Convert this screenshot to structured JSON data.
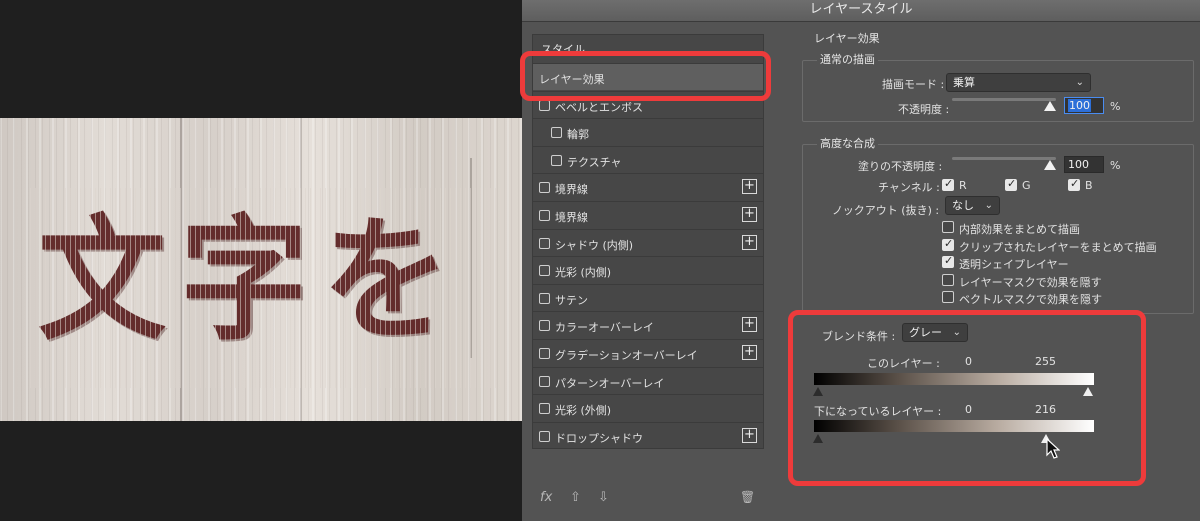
{
  "artwork": {
    "text": "文字を"
  },
  "dialog": {
    "title": "レイヤースタイル",
    "style_header": "スタイル",
    "style_items": [
      {
        "label": "レイヤー効果",
        "checkbox": false,
        "plus": false,
        "selected": true
      },
      {
        "label": "ベベルとエンボス",
        "checkbox": true,
        "plus": false
      },
      {
        "label": "輪郭",
        "checkbox": true,
        "plus": false,
        "indent": true
      },
      {
        "label": "テクスチャ",
        "checkbox": true,
        "plus": false,
        "indent": true
      },
      {
        "label": "境界線",
        "checkbox": true,
        "plus": true
      },
      {
        "label": "境界線",
        "checkbox": true,
        "plus": true
      },
      {
        "label": "シャドウ (内側)",
        "checkbox": true,
        "plus": true
      },
      {
        "label": "光彩 (内側)",
        "checkbox": true,
        "plus": false
      },
      {
        "label": "サテン",
        "checkbox": true,
        "plus": false
      },
      {
        "label": "カラーオーバーレイ",
        "checkbox": true,
        "plus": true
      },
      {
        "label": "グラデーションオーバーレイ",
        "checkbox": true,
        "plus": true
      },
      {
        "label": "パターンオーバーレイ",
        "checkbox": true,
        "plus": false
      },
      {
        "label": "光彩 (外側)",
        "checkbox": true,
        "plus": false
      },
      {
        "label": "ドロップシャドウ",
        "checkbox": true,
        "plus": true
      }
    ],
    "footer": {
      "fx": "fx",
      "up": "⇧",
      "down": "⇩",
      "trash": "🗑"
    },
    "layer_effects_title": "レイヤー効果",
    "normal_blend": {
      "title": "通常の描画",
      "blend_mode_label": "描画モード :",
      "blend_mode_value": "乗算",
      "opacity_label": "不透明度 :",
      "opacity_value": "100",
      "opacity_unit": "%"
    },
    "advanced_blend": {
      "title": "高度な合成",
      "fill_opacity_label": "塗りの不透明度 :",
      "fill_opacity_value": "100",
      "fill_opacity_unit": "%",
      "channels_label": "チャンネル :",
      "channels": [
        "R",
        "G",
        "B"
      ],
      "knockout_label": "ノックアウト (抜き) :",
      "knockout_value": "なし",
      "options": [
        {
          "label": "内部効果をまとめて描画",
          "checked": false
        },
        {
          "label": "クリップされたレイヤーをまとめて描画",
          "checked": true
        },
        {
          "label": "透明シェイプレイヤー",
          "checked": true
        },
        {
          "label": "レイヤーマスクで効果を隠す",
          "checked": false
        },
        {
          "label": "ベクトルマスクで効果を隠す",
          "checked": false
        }
      ]
    },
    "blend_if": {
      "label": "ブレンド条件 :",
      "value": "グレー",
      "this_layer_label": "このレイヤー :",
      "this_layer_min": "0",
      "this_layer_max": "255",
      "underlying_label": "下になっているレイヤー :",
      "underlying_min": "0",
      "underlying_max": "216"
    },
    "colors": {
      "highlight": "#ee3b3b",
      "focus": "#2d6fd8"
    }
  }
}
